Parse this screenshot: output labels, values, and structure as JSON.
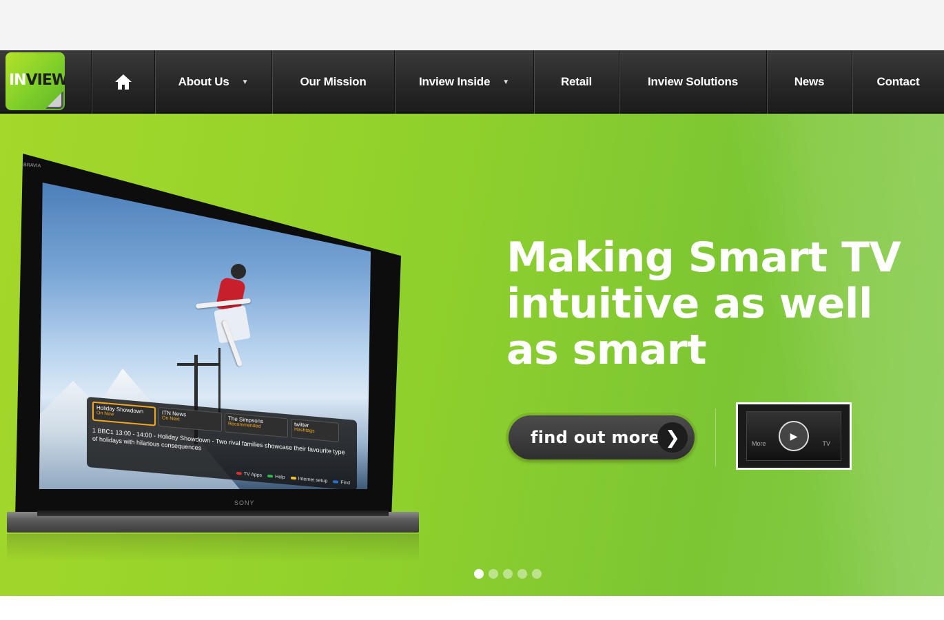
{
  "logo": {
    "text_in": "IN",
    "text_view": "VIEW"
  },
  "nav": {
    "home_icon": "home-icon",
    "items": [
      {
        "label": "About Us",
        "has_dropdown": true
      },
      {
        "label": "Our Mission",
        "has_dropdown": false
      },
      {
        "label": "Inview Inside",
        "has_dropdown": true
      },
      {
        "label": "Retail",
        "has_dropdown": false
      },
      {
        "label": "Inview Solutions",
        "has_dropdown": false
      },
      {
        "label": "News",
        "has_dropdown": false
      },
      {
        "label": "Contact",
        "has_dropdown": false
      }
    ],
    "dropdown_glyph": "▼"
  },
  "hero": {
    "headline": "Making Smart TV intuitive as well as smart",
    "cta_label": "find out more",
    "cta_arrow": "❯",
    "video": {
      "caption_left": "More",
      "caption_right": "TV",
      "play_icon": "play-icon"
    },
    "slides": {
      "count": 5,
      "active": 1
    }
  },
  "tv": {
    "brand_top": "BRAVIA",
    "brand_bottom": "SONY",
    "epg": {
      "cards": [
        {
          "title": "Holiday Showdown",
          "sub": "On Now"
        },
        {
          "title": "ITN News",
          "sub": "On Next"
        },
        {
          "title": "The Simpsons",
          "sub": "Recommended"
        },
        {
          "title": "twitter",
          "sub": "Hashtags"
        }
      ],
      "detail": "1 BBC1 13:00 - 14:00 - Holiday Showdown - Two rival families showcase their favourite type of holidays with hilarious consequences",
      "legend": [
        {
          "label": "TV Apps",
          "color": "#d9322a"
        },
        {
          "label": "Help",
          "color": "#37b24a"
        },
        {
          "label": "Internet setup",
          "color": "#f1c232"
        },
        {
          "label": "Find",
          "color": "#2f6fd0"
        }
      ]
    }
  },
  "colors": {
    "nav_bg": "#262626",
    "hero_green": "#8fd02c",
    "brand_green": "#7fcf2a",
    "cta_bg": "#3a3a3a"
  }
}
